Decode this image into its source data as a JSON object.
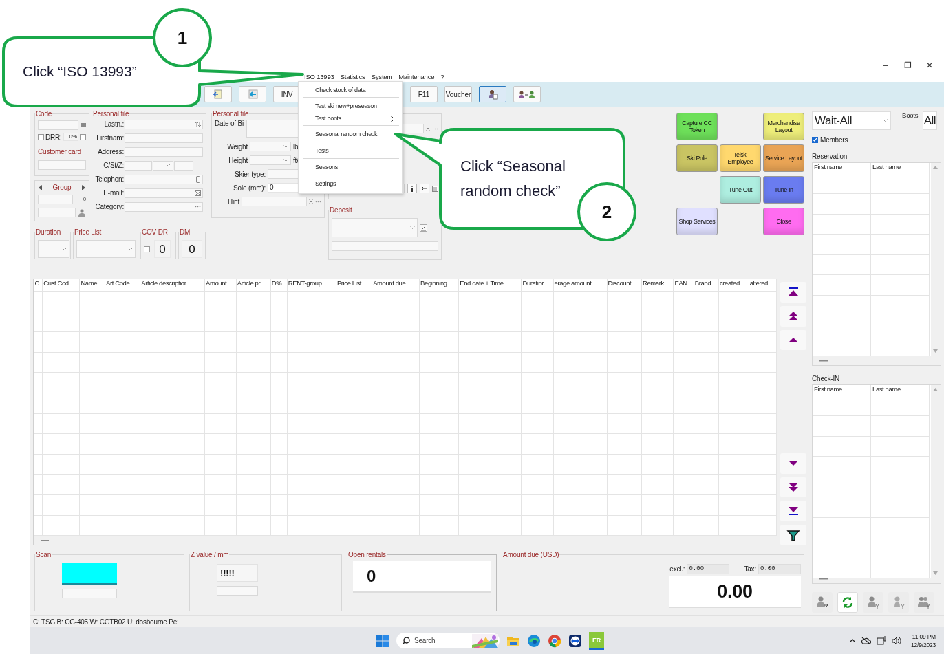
{
  "window": {
    "controls": [
      "–",
      "❐",
      "✕"
    ]
  },
  "menu_bar": {
    "items": [
      {
        "label": "ISO 13993"
      },
      {
        "label": "Statistics"
      },
      {
        "label": "System"
      },
      {
        "label": "Maintenance"
      },
      {
        "label": "?"
      }
    ]
  },
  "toolbar": {
    "left_buttons": [
      {
        "kind": "icon",
        "selected": false
      },
      {
        "kind": "icon",
        "selected": false
      },
      {
        "kind": "text",
        "label": "INV",
        "selected": false
      }
    ],
    "right_buttons": [
      {
        "kind": "text",
        "label": "F11",
        "selected": false
      },
      {
        "kind": "text",
        "label": "Voucher",
        "selected": false
      },
      {
        "kind": "icon",
        "selected": true
      },
      {
        "kind": "icon",
        "selected": false
      }
    ]
  },
  "dropdown_menu": {
    "items": [
      {
        "label": "Check stock of data",
        "separator_before": false,
        "submenu": false
      },
      {
        "label": "Test ski new+preseason",
        "separator_before": true,
        "submenu": false
      },
      {
        "label": "Test boots",
        "separator_before": false,
        "submenu": true
      },
      {
        "label": "Seasonal random check",
        "separator_before": true,
        "submenu": false
      },
      {
        "label": "Tests",
        "separator_before": true,
        "submenu": false
      },
      {
        "label": "Seasons",
        "separator_before": true,
        "submenu": false
      },
      {
        "label": "Settings",
        "separator_before": true,
        "submenu": false
      }
    ]
  },
  "code_box": {
    "legend": "Code",
    "drr_checked": false,
    "drr_label": "DRR:",
    "drr_value": "0%",
    "flag_checked": false,
    "customer_card": "Customer card"
  },
  "group_box": {
    "label": "Group",
    "count": "0"
  },
  "personal_file": {
    "legend": "Personal file",
    "fields": [
      {
        "label": "Lastn.:"
      },
      {
        "label": "Firstnam:"
      },
      {
        "label": "Address:"
      },
      {
        "label": "C/St/Z:"
      },
      {
        "label": "Telephon:"
      },
      {
        "label": "E-mail:"
      },
      {
        "label": "Category:"
      }
    ]
  },
  "personal_file_2": {
    "legend": "Personal file",
    "date_label": "Date of Bi",
    "weight_label": "Weight",
    "weight_unit": "lb",
    "height_label": "Height",
    "height_unit": "ft/",
    "skier_type_label": "Skier type:",
    "sole_label": "Sole (mm):",
    "sole_value": "0",
    "hint_label": "Hint"
  },
  "duration_row": {
    "duration": "Duration",
    "price_list": "Price List",
    "cov_dr": "COV DR",
    "cov_checked": false,
    "dr_value": "0",
    "dm": "DM",
    "dm_value": "0"
  },
  "deposit": {
    "legend": "Deposit"
  },
  "action_buttons": {
    "rows": [
      [
        {
          "kind": "button",
          "label": "Capture CC Token",
          "color": "#6ee05a"
        },
        {
          "kind": "blank"
        },
        {
          "kind": "button",
          "label": "Merchandise Layout",
          "color": "#eeee7a"
        }
      ],
      [
        {
          "kind": "button",
          "label": "Ski Pole",
          "color": "#c9c463"
        },
        {
          "kind": "button",
          "label": "Telski Employee",
          "color": "#ffd86e"
        },
        {
          "kind": "button",
          "label": "Service Layout",
          "color": "#e9a455"
        }
      ],
      [
        {
          "kind": "blank"
        },
        {
          "kind": "button",
          "label": "Tune Out",
          "color": "#aeeee0"
        },
        {
          "kind": "button",
          "label": "Tune In",
          "color": "#6a7cf0"
        }
      ],
      [
        {
          "kind": "button",
          "label": "Shop Services",
          "color": "#e0e0ff"
        },
        {
          "kind": "blank"
        },
        {
          "kind": "button",
          "label": "Close",
          "color": "#ff6cf0"
        }
      ]
    ]
  },
  "articles_table": {
    "columns": [
      "C",
      "Cust.Cod",
      "Name",
      "Art.Code",
      "Article descriptior",
      "Amount",
      "Article pr",
      "D%",
      "RENT-group",
      "Price List",
      "Amount due",
      "Beginning",
      "End date + Time",
      "Duratior",
      "erage amount",
      "Discount",
      "Remark",
      "EAN",
      "Brand",
      "created",
      "altered"
    ]
  },
  "right_panel": {
    "wait_filter": "Wait-All",
    "boots_label": "Boots:",
    "boots_value": "All",
    "members": {
      "label": "Members",
      "checked": true
    },
    "reservation": {
      "title": "Reservation",
      "columns": [
        "First name",
        "Last name"
      ]
    },
    "check_in": {
      "title": "Check-IN",
      "columns": [
        "First name",
        "Last name"
      ]
    }
  },
  "bottom": {
    "scan": {
      "legend": "Scan"
    },
    "z_value": {
      "legend": "Z value / mm",
      "value": "!!!!!"
    },
    "open_rentals": {
      "legend": "Open rentals",
      "value": "0"
    },
    "amount_due": {
      "legend": "Amount due (USD)",
      "excl_label": "excl.:",
      "excl_value": "0.00",
      "tax_label": "Tax:",
      "tax_value": "0.00",
      "total": "0.00"
    }
  },
  "status_bar": "C: TSG B: CG-405 W: CGTB02 U: dosbourne Pe:",
  "taskbar": {
    "search_placeholder": "Search",
    "app_label": "ER",
    "time": "11:09 PM",
    "date": "12/9/2023"
  },
  "callouts": [
    {
      "number": "1",
      "text": "Click “ISO 13993”"
    },
    {
      "number": "2",
      "text": "Click “Seasonal random check”"
    }
  ]
}
